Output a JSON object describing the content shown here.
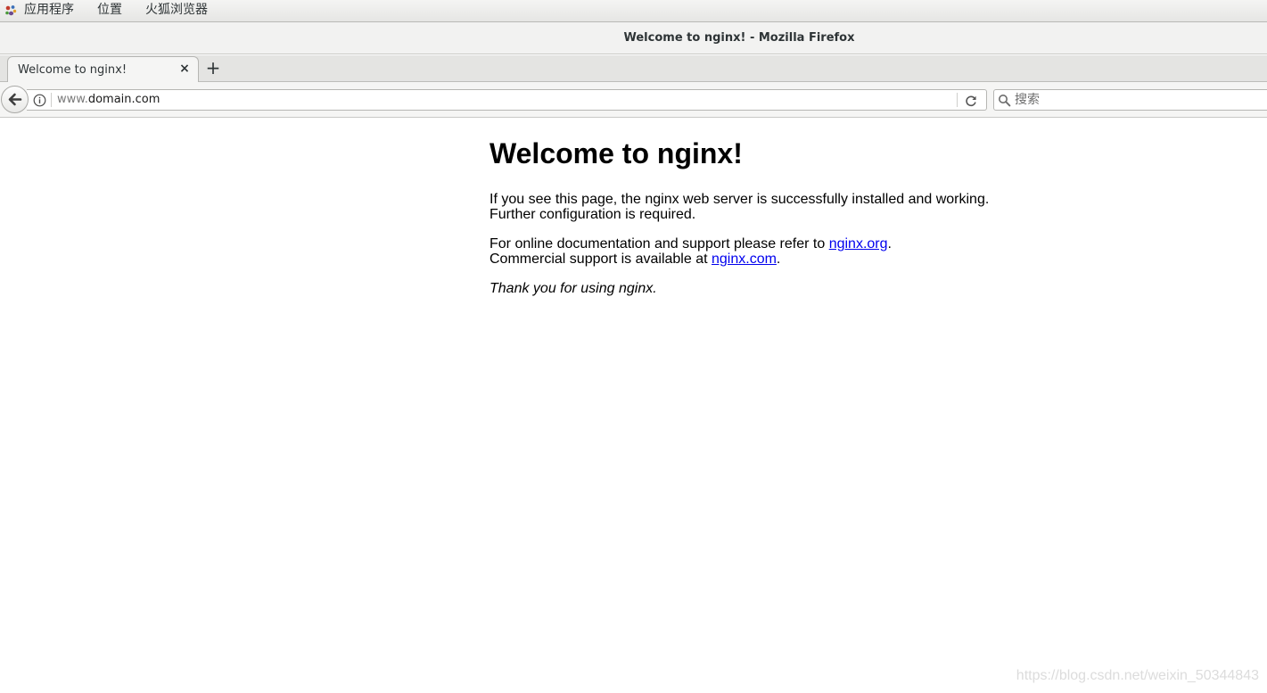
{
  "topbar": {
    "applications": "应用程序",
    "places": "位置",
    "firefox": "火狐浏览器",
    "apps_icon": "gnome-foot-icon"
  },
  "window": {
    "title": "Welcome to nginx! - Mozilla Firefox"
  },
  "tabs": [
    {
      "label": "Welcome to nginx!",
      "close": "×",
      "active": true
    }
  ],
  "newtab": "+",
  "navbar": {
    "url_prefix": "www.",
    "url_domain": "domain.com",
    "search_placeholder": "搜索"
  },
  "page": {
    "heading": "Welcome to nginx!",
    "p1_line1": "If you see this page, the nginx web server is successfully installed and working.",
    "p1_line2": "Further configuration is required.",
    "p2_text1": "For online documentation and support please refer to ",
    "p2_link1": "nginx.org",
    "p2_dot1": ".",
    "p2_text2": "Commercial support is available at ",
    "p2_link2": "nginx.com",
    "p2_dot2": ".",
    "p3": "Thank you for using nginx."
  },
  "watermark": "https://blog.csdn.net/weixin_50344843",
  "colors": {
    "link": "#0000ee",
    "chrome_bg": "#f5f5f4",
    "tab_strip_bg": "#e4e4e2"
  }
}
